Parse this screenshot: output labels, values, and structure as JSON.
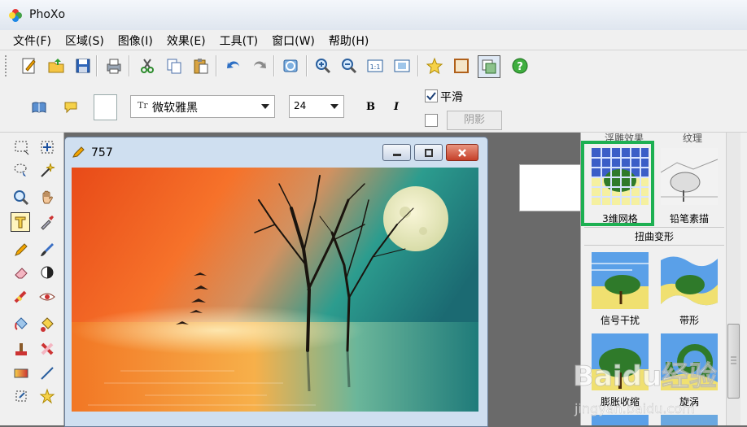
{
  "app": {
    "title": "PhoXo"
  },
  "menu": [
    "文件(F)",
    "区域(S)",
    "图像(I)",
    "效果(E)",
    "工具(T)",
    "窗口(W)",
    "帮助(H)"
  ],
  "toolbar": {
    "icons": [
      "new-document-icon",
      "open-folder-icon",
      "save-icon",
      "print-icon",
      "cut-icon",
      "copy-icon",
      "paste-icon",
      "undo-icon",
      "redo-icon",
      "refresh-icon",
      "zoom-in-icon",
      "zoom-out-icon",
      "actual-size-icon",
      "fit-window-icon",
      "star-icon",
      "frame-icon",
      "layers-icon",
      "help-icon"
    ]
  },
  "text_options": {
    "font": "微软雅黑",
    "font_prefix": "Tr",
    "size": "24",
    "bold": "B",
    "italic": "I",
    "smooth_label": "平滑",
    "smooth_checked": true,
    "shadow_label": "阴影",
    "shadow_checked": false
  },
  "document": {
    "title": "757"
  },
  "effects": {
    "top_partial": [
      "浮雕效果",
      "纹理"
    ],
    "row1": [
      "3维网格",
      "铅笔素描"
    ],
    "group_label": "扭曲变形",
    "row2": [
      "信号干扰",
      "带形"
    ],
    "row3": [
      "膨胀收缩",
      "旋涡"
    ],
    "selected": "3维网格"
  },
  "watermark": {
    "text": "Baidu经验",
    "sub": "jingyan.baidu.com"
  },
  "colors": {
    "highlight": "#1db052",
    "title_bg": "#e3eaf3",
    "selected_tool": "#fff5bf"
  }
}
